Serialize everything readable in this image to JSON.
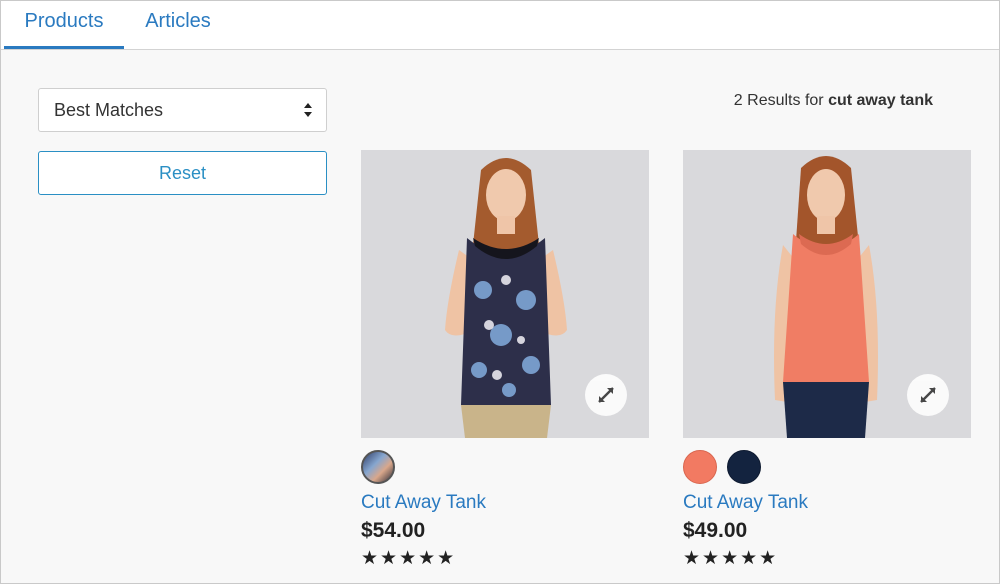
{
  "tabs": [
    {
      "label": "Products",
      "active": true
    },
    {
      "label": "Articles",
      "active": false
    }
  ],
  "sidebar": {
    "sort_select": {
      "selected": "Best Matches",
      "icon": "sort-arrows-icon"
    },
    "reset_label": "Reset"
  },
  "results": {
    "count_text": "2 Results for",
    "query": "cut away tank"
  },
  "products": [
    {
      "name": "Cut Away Tank",
      "price": "$54.00",
      "stars": "★★★★★",
      "rating": 5,
      "swatches": [
        {
          "color": "#4b6aa8",
          "name": "print"
        }
      ],
      "top_color": "#2d2f4a"
    },
    {
      "name": "Cut Away Tank",
      "price": "$49.00",
      "stars": "★★★★★",
      "rating": 5,
      "swatches": [
        {
          "color": "#f27a62",
          "name": "coral"
        },
        {
          "color": "#13233f",
          "name": "navy"
        }
      ],
      "top_color": "#f07d64"
    }
  ],
  "colors": {
    "accent": "#2a7ac0",
    "reset_border": "#2a8fc4",
    "background": "#f8f8f8"
  }
}
